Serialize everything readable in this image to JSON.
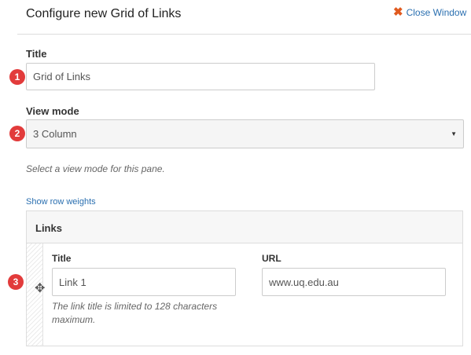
{
  "header": {
    "title": "Configure new Grid of Links",
    "close_label": "Close Window",
    "close_icon": "close-x-icon",
    "close_icon_color": "#e05a1f"
  },
  "annotations": [
    "1",
    "2",
    "3"
  ],
  "colors": {
    "link": "#2a6fb0",
    "badge": "#e23b3b"
  },
  "form": {
    "title_label": "Title",
    "title_value": "Grid of Links",
    "view_mode_label": "View mode",
    "view_mode_value": "3 Column",
    "view_mode_help": "Select a view mode for this pane.",
    "show_row_weights": "Show row weights"
  },
  "links": {
    "header": "Links",
    "row_title_label": "Title",
    "row_url_label": "URL",
    "row_title_value": "Link 1",
    "row_url_value": "www.uq.edu.au",
    "row_title_help_line1": "The link title is limited to 128 characters",
    "row_title_help_line2": "maximum."
  }
}
